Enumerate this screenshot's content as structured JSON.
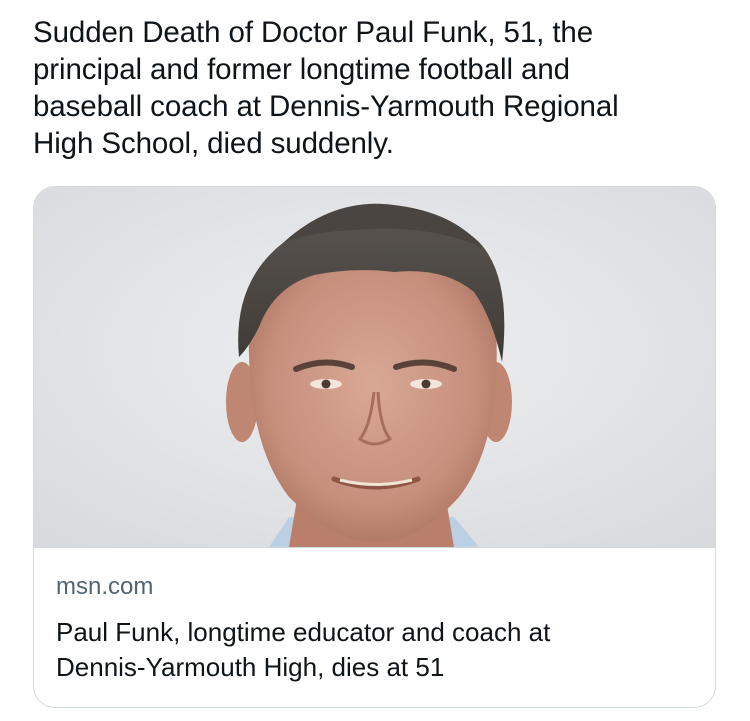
{
  "tweet": {
    "text": "Sudden Death of Doctor Paul Funk, 51, the\nprincipal and former longtime football and\nbaseball coach at Dennis-Yarmouth Regional\nHigh School, died suddenly."
  },
  "link_card": {
    "image_subject": "portrait-photo",
    "domain": "msn.com",
    "title": "Paul Funk, longtime educator and coach at\nDennis-Yarmouth High, dies at 51"
  },
  "colors": {
    "text": "#0f1419",
    "secondary_text": "#536471",
    "card_border": "#cfd9de",
    "photo_background": "#e3e4e6"
  }
}
